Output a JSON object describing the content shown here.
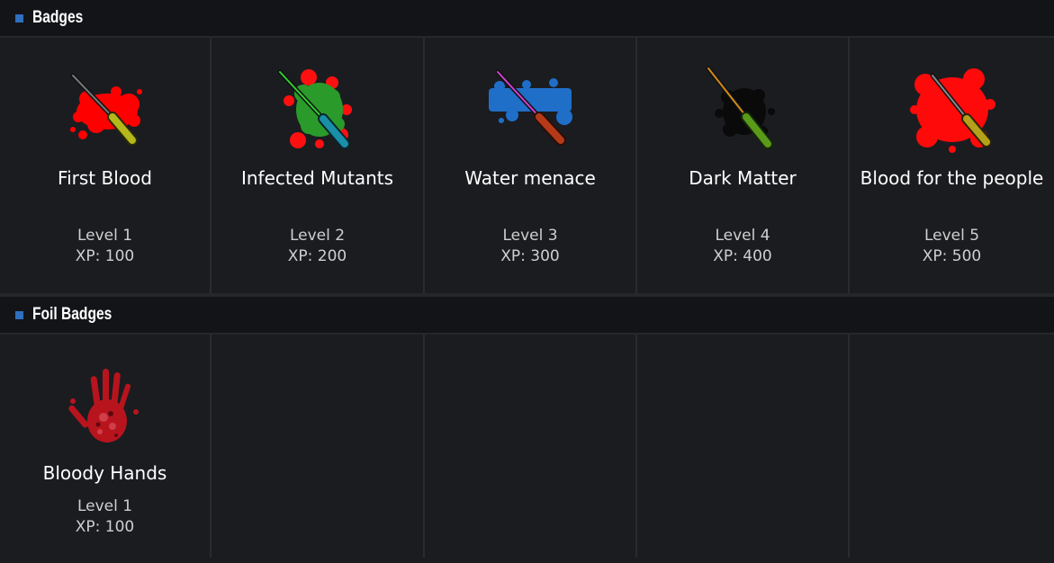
{
  "sections": {
    "badges": {
      "title": "Badges",
      "items": [
        {
          "name": "First Blood",
          "level": "Level 1",
          "xp": "XP: 100",
          "icon": "screwdriver-red-splatter-icon",
          "splat_color": "#ff0000",
          "handle_color": "#b5b81a"
        },
        {
          "name": "Infected Mutants",
          "level": "Level 2",
          "xp": "XP: 200",
          "icon": "screwdriver-green-splatter-icon",
          "splat_color": "#2a9a2a",
          "handle_color": "#1a8fa8"
        },
        {
          "name": "Water menace",
          "level": "Level 3",
          "xp": "XP: 300",
          "icon": "screwdriver-blue-splatter-icon",
          "splat_color": "#1f6fc9",
          "handle_color": "#b53a1a"
        },
        {
          "name": "Dark Matter",
          "level": "Level 4",
          "xp": "XP: 400",
          "icon": "screwdriver-black-splatter-icon",
          "splat_color": "#0a0a0a",
          "handle_color": "#5a9a1a"
        },
        {
          "name": "Blood for the people",
          "level": "Level 5",
          "xp": "XP: 500",
          "icon": "screwdriver-large-red-splatter-icon",
          "splat_color": "#ff0a0a",
          "handle_color": "#b5a01a"
        }
      ]
    },
    "foil": {
      "title": "Foil Badges",
      "items": [
        {
          "name": "Bloody Hands",
          "level": "Level 1",
          "xp": "XP: 100",
          "icon": "bloody-handprint-icon"
        }
      ]
    }
  }
}
